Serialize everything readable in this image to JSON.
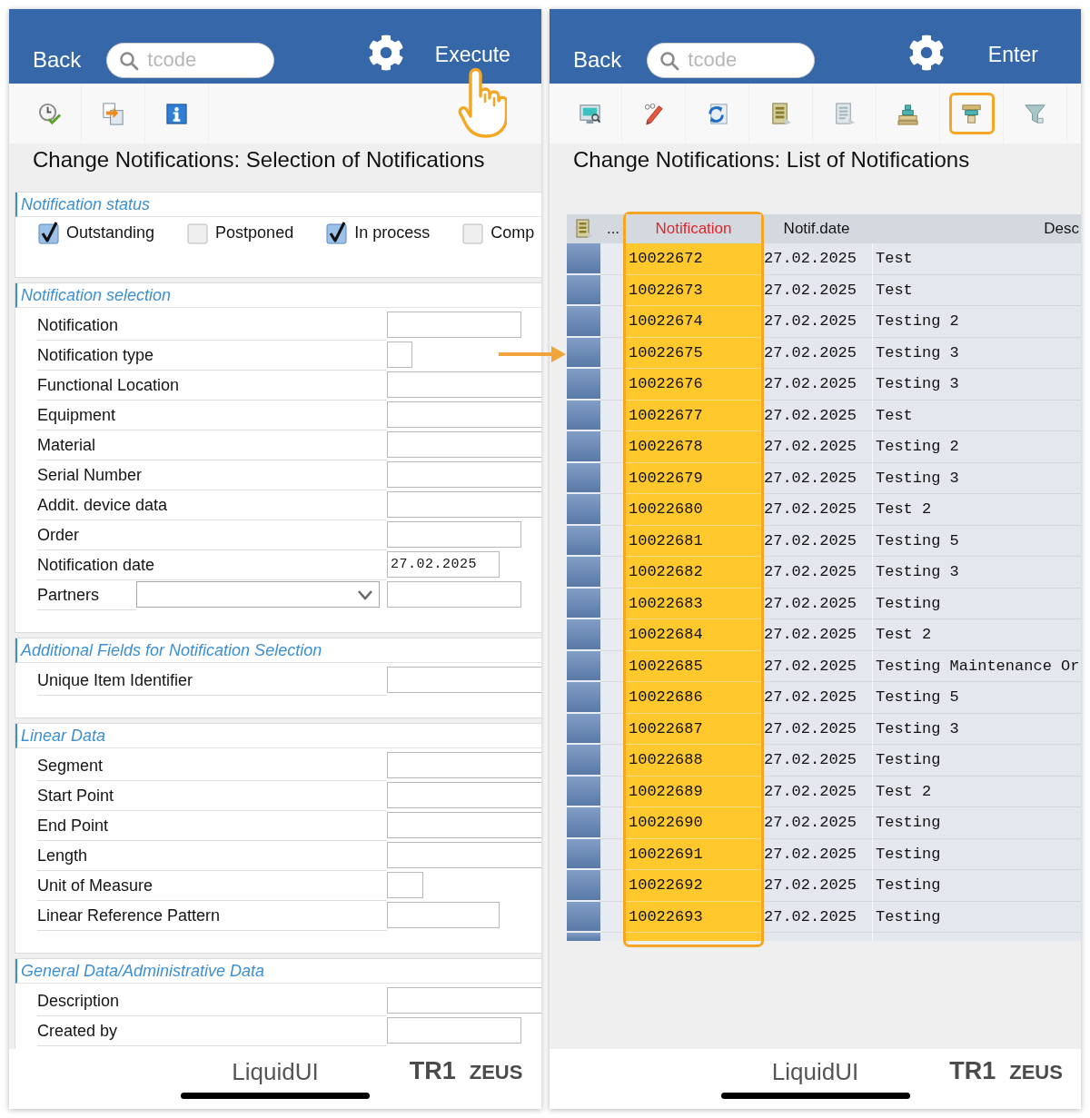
{
  "screens": [
    {
      "kind": "form",
      "header": {
        "back": "Back",
        "search": {
          "placeholder": "tcode"
        },
        "action": "Execute",
        "tapped": true
      },
      "toolbar": [
        {
          "kind": "clock",
          "highlighted": false
        },
        {
          "kind": "transfer",
          "highlighted": false
        },
        {
          "kind": "info",
          "highlighted": false
        }
      ],
      "title": "Change Notifications: Selection of Notifications",
      "sections": [
        {
          "kind": "checkboxes",
          "title": "Notification status",
          "items": [
            {
              "label": "Outstanding",
              "checked": true
            },
            {
              "label": "Postponed",
              "checked": false
            },
            {
              "label": "In process",
              "checked": true
            },
            {
              "label": "Comp",
              "checked": false
            }
          ]
        },
        {
          "kind": "fields",
          "title": "Notification selection",
          "fields": [
            {
              "label": "Notification",
              "kind": "input"
            },
            {
              "label": "Notification type",
              "kind": "input"
            },
            {
              "label": "Functional Location",
              "kind": "input"
            },
            {
              "label": "Equipment",
              "kind": "input"
            },
            {
              "label": "Material",
              "kind": "input"
            },
            {
              "label": "Serial Number",
              "kind": "input"
            },
            {
              "label": "Addit. device data",
              "kind": "input"
            },
            {
              "label": "Order",
              "kind": "input"
            },
            {
              "label": "Notification date",
              "kind": "input",
              "value": "27.02.2025"
            },
            {
              "label": "Partners",
              "kind": "select"
            }
          ]
        },
        {
          "kind": "fields",
          "title": "Additional Fields for Notification Selection",
          "fields": [
            {
              "label": "Unique Item Identifier",
              "kind": "input"
            }
          ]
        },
        {
          "kind": "fields",
          "title": "Linear Data",
          "fields": [
            {
              "label": "Segment",
              "kind": "input"
            },
            {
              "label": "Start Point",
              "kind": "input"
            },
            {
              "label": "End Point",
              "kind": "input"
            },
            {
              "label": "Length",
              "kind": "input"
            },
            {
              "label": "Unit of Measure",
              "kind": "input"
            },
            {
              "label": "Linear Reference Pattern",
              "kind": "input"
            }
          ]
        },
        {
          "kind": "fields",
          "title": "General Data/Administrative Data",
          "fields": [
            {
              "label": "Description",
              "kind": "input"
            },
            {
              "label": "Created by",
              "kind": "input"
            }
          ]
        }
      ],
      "footer": {
        "brand": "LiquidUI",
        "system": "TR1",
        "server": "ZEUS"
      }
    },
    {
      "kind": "list",
      "header": {
        "back": "Back",
        "search": {
          "placeholder": "tcode"
        },
        "action": "Enter",
        "tapped": false
      },
      "toolbar": [
        {
          "kind": "monitor",
          "highlighted": false
        },
        {
          "kind": "pencil",
          "highlighted": false
        },
        {
          "kind": "refresh",
          "highlighted": false
        },
        {
          "kind": "list",
          "highlighted": false
        },
        {
          "kind": "page",
          "highlighted": false
        },
        {
          "kind": "pyramid",
          "highlighted": false
        },
        {
          "kind": "layers",
          "highlighted": true
        },
        {
          "kind": "funnel",
          "highlighted": false
        }
      ],
      "title": "Change Notifications: List of Notifications",
      "table": {
        "menu_column": "...",
        "columns": [
          {
            "label": "Notification",
            "selected": true,
            "highlighted": true
          },
          {
            "label": "Notif.date",
            "selected": false,
            "highlighted": false
          },
          {
            "label": "Desc",
            "selected": false,
            "highlighted": false
          }
        ],
        "rows": [
          {
            "cells": [
              "10022672",
              "27.02.2025",
              "Test"
            ]
          },
          {
            "cells": [
              "10022673",
              "27.02.2025",
              "Test"
            ]
          },
          {
            "cells": [
              "10022674",
              "27.02.2025",
              "Testing 2"
            ]
          },
          {
            "cells": [
              "10022675",
              "27.02.2025",
              "Testing 3"
            ]
          },
          {
            "cells": [
              "10022676",
              "27.02.2025",
              "Testing 3"
            ]
          },
          {
            "cells": [
              "10022677",
              "27.02.2025",
              "Test"
            ]
          },
          {
            "cells": [
              "10022678",
              "27.02.2025",
              "Testing 2"
            ]
          },
          {
            "cells": [
              "10022679",
              "27.02.2025",
              "Testing 3"
            ]
          },
          {
            "cells": [
              "10022680",
              "27.02.2025",
              "Test 2"
            ]
          },
          {
            "cells": [
              "10022681",
              "27.02.2025",
              "Testing 5"
            ]
          },
          {
            "cells": [
              "10022682",
              "27.02.2025",
              "Testing 3"
            ]
          },
          {
            "cells": [
              "10022683",
              "27.02.2025",
              "Testing"
            ]
          },
          {
            "cells": [
              "10022684",
              "27.02.2025",
              "Test 2"
            ]
          },
          {
            "cells": [
              "10022685",
              "27.02.2025",
              "Testing Maintenance Or"
            ]
          },
          {
            "cells": [
              "10022686",
              "27.02.2025",
              "Testing 5"
            ]
          },
          {
            "cells": [
              "10022687",
              "27.02.2025",
              "Testing 3"
            ]
          },
          {
            "cells": [
              "10022688",
              "27.02.2025",
              "Testing"
            ]
          },
          {
            "cells": [
              "10022689",
              "27.02.2025",
              "Test 2"
            ]
          },
          {
            "cells": [
              "10022690",
              "27.02.2025",
              "Testing"
            ]
          },
          {
            "cells": [
              "10022691",
              "27.02.2025",
              "Testing"
            ]
          },
          {
            "cells": [
              "10022692",
              "27.02.2025",
              "Testing"
            ]
          },
          {
            "cells": [
              "10022693",
              "27.02.2025",
              "Testing"
            ]
          }
        ]
      },
      "footer": {
        "brand": "LiquidUI",
        "system": "TR1",
        "server": "ZEUS"
      }
    }
  ]
}
